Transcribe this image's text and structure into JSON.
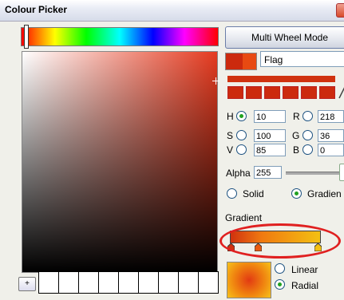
{
  "window": {
    "title": "Colour Picker"
  },
  "mode_button": "Multi Wheel Mode",
  "color_name": "Flag",
  "hsv": {
    "h_label": "H",
    "h": "10",
    "s_label": "S",
    "s": "100",
    "v_label": "V",
    "v": "85"
  },
  "rgb": {
    "r_label": "R",
    "r": "218",
    "g_label": "G",
    "g": "36",
    "b_label": "B",
    "b": "0"
  },
  "alpha": {
    "label": "Alpha",
    "value": "255"
  },
  "fill": {
    "solid": "Solid",
    "gradient": "Gradien"
  },
  "gradient": {
    "label": "Gradient",
    "linear": "Linear",
    "radial": "Radial"
  },
  "add_swatch": "+",
  "colors": {
    "current": "#cc2a0e",
    "accent": "#21a121",
    "highlight": "#e02020"
  }
}
